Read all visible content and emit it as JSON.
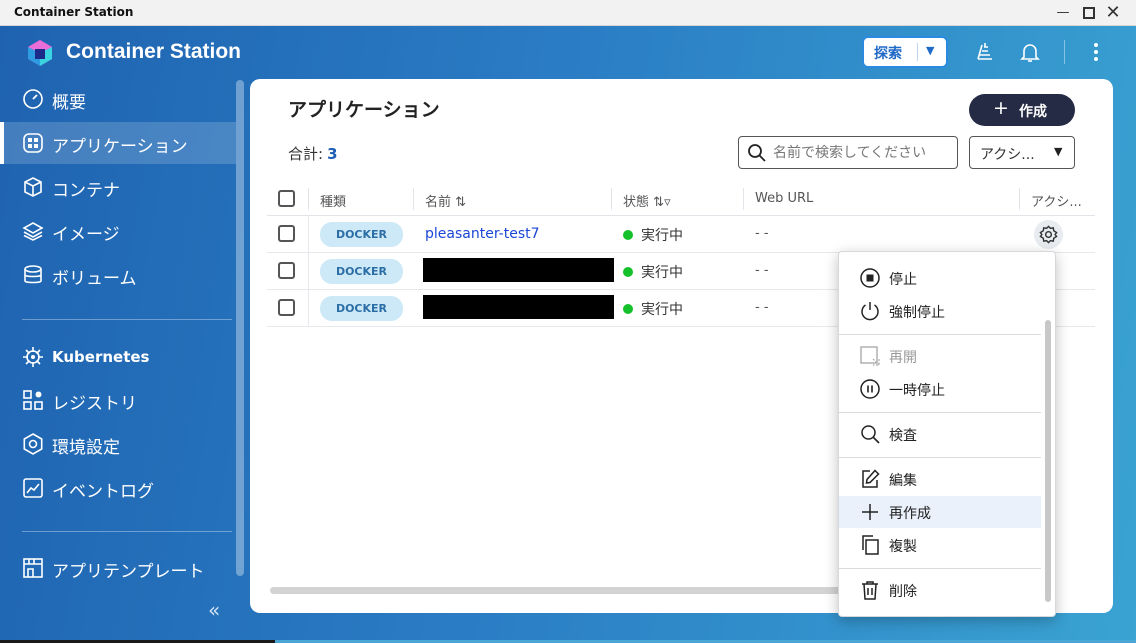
{
  "window": {
    "title": "Container Station"
  },
  "header": {
    "brand_name": "Container Station",
    "explore_label": "探索"
  },
  "sidebar": {
    "items": [
      {
        "label": "概要",
        "icon": "dashboard-gauge-icon"
      },
      {
        "label": "アプリケーション",
        "icon": "apps-grid-icon",
        "active": true
      },
      {
        "label": "コンテナ",
        "icon": "cube-icon"
      },
      {
        "label": "イメージ",
        "icon": "layers-icon"
      },
      {
        "label": "ボリューム",
        "icon": "database-icon"
      },
      {
        "label": "Kubernetes",
        "icon": "helm-wheel-icon"
      },
      {
        "label": "レジストリ",
        "icon": "registry-grid-icon"
      },
      {
        "label": "環境設定",
        "icon": "gear-icon"
      },
      {
        "label": "イベントログ",
        "icon": "chart-log-icon"
      },
      {
        "label": "アプリテンプレート",
        "icon": "store-template-icon"
      }
    ]
  },
  "main": {
    "title": "アプリケーション",
    "create_label": "作成",
    "total_label": "合計:",
    "total_count": "3",
    "search_placeholder": "名前で検索してください",
    "actions_label": "アクシ...",
    "columns": {
      "type": "種類",
      "name": "名前",
      "status": "状態",
      "web_url": "Web URL",
      "actions": "アクシ..."
    },
    "rows": [
      {
        "type": "DOCKER",
        "name": "pleasanter-test7",
        "redacted": false,
        "status": "実行中",
        "web_url": "- -"
      },
      {
        "type": "DOCKER",
        "name": "",
        "redacted": true,
        "status": "実行中",
        "web_url": "- -"
      },
      {
        "type": "DOCKER",
        "name": "",
        "redacted": true,
        "status": "実行中",
        "web_url": "- -"
      }
    ]
  },
  "context_menu": {
    "items": [
      {
        "label": "停止",
        "icon": "stop-icon"
      },
      {
        "label": "強制停止",
        "icon": "power-icon"
      },
      {
        "label": "再開",
        "icon": "resume-icon",
        "disabled": true
      },
      {
        "label": "一時停止",
        "icon": "pause-icon"
      },
      {
        "label": "検査",
        "icon": "search-icon"
      },
      {
        "label": "編集",
        "icon": "edit-icon"
      },
      {
        "label": "再作成",
        "icon": "plus-icon",
        "highlighted": true
      },
      {
        "label": "複製",
        "icon": "copy-icon"
      },
      {
        "label": "削除",
        "icon": "trash-icon"
      }
    ]
  },
  "colors": {
    "accent": "#2069c7",
    "running": "#15c12a",
    "badge_bg": "#cde9f7",
    "create_button": "#252a45"
  }
}
